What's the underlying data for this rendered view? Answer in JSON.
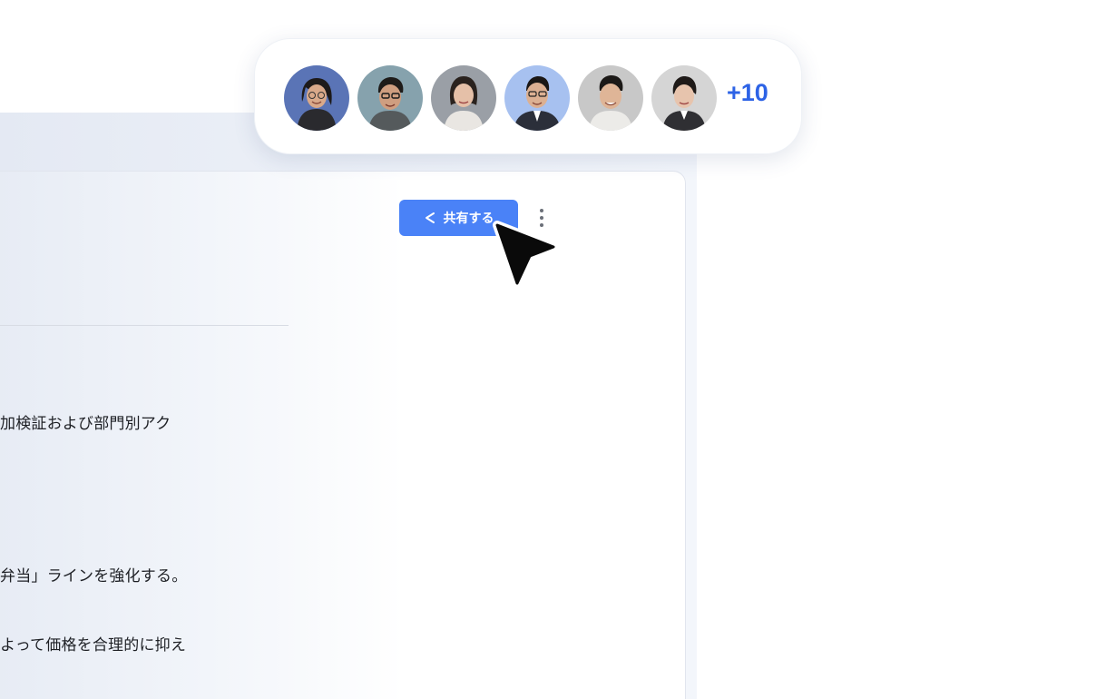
{
  "document": {
    "lines": [
      "加検証および部門別アク",
      "弁当」ラインを強化する。",
      "よって価格を合理的に抑え"
    ]
  },
  "toolbar": {
    "share_label": "共有する",
    "share_icon": "share-icon",
    "more_icon": "more-vertical-icon"
  },
  "collaborators": {
    "avatars": [
      {
        "name": "avatar-1",
        "bg": "#5a74b6"
      },
      {
        "name": "avatar-2",
        "bg": "#86a2ad"
      },
      {
        "name": "avatar-3",
        "bg": "#9a9fa6"
      },
      {
        "name": "avatar-4",
        "bg": "#a7c1f0"
      },
      {
        "name": "avatar-5",
        "bg": "#c8c8c8"
      },
      {
        "name": "avatar-6",
        "bg": "#d5d5d5"
      }
    ],
    "extra_count": "+10"
  },
  "colors": {
    "accent": "#4a82f7",
    "count_text": "#2d63e6"
  }
}
